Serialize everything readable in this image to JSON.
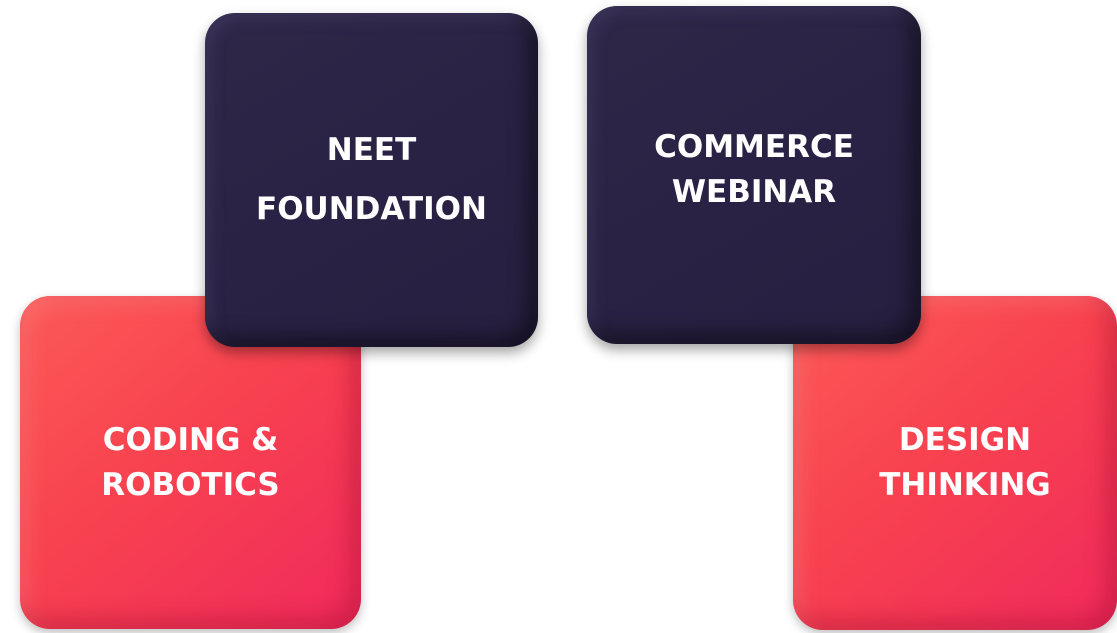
{
  "tiles": {
    "neet": {
      "line1": "NEET",
      "line2": "FOUNDATION"
    },
    "commerce": {
      "line1": "COMMERCE",
      "line2": "WEBINAR"
    },
    "coding": {
      "line1": "CODING &",
      "line2": "ROBOTICS"
    },
    "design": {
      "line1": "DESIGN",
      "line2": "THINKING"
    }
  },
  "colors": {
    "dark_tile": "#2a2244",
    "red_tile": "#f8424f",
    "text": "#ffffff",
    "background": "#ffffff"
  }
}
